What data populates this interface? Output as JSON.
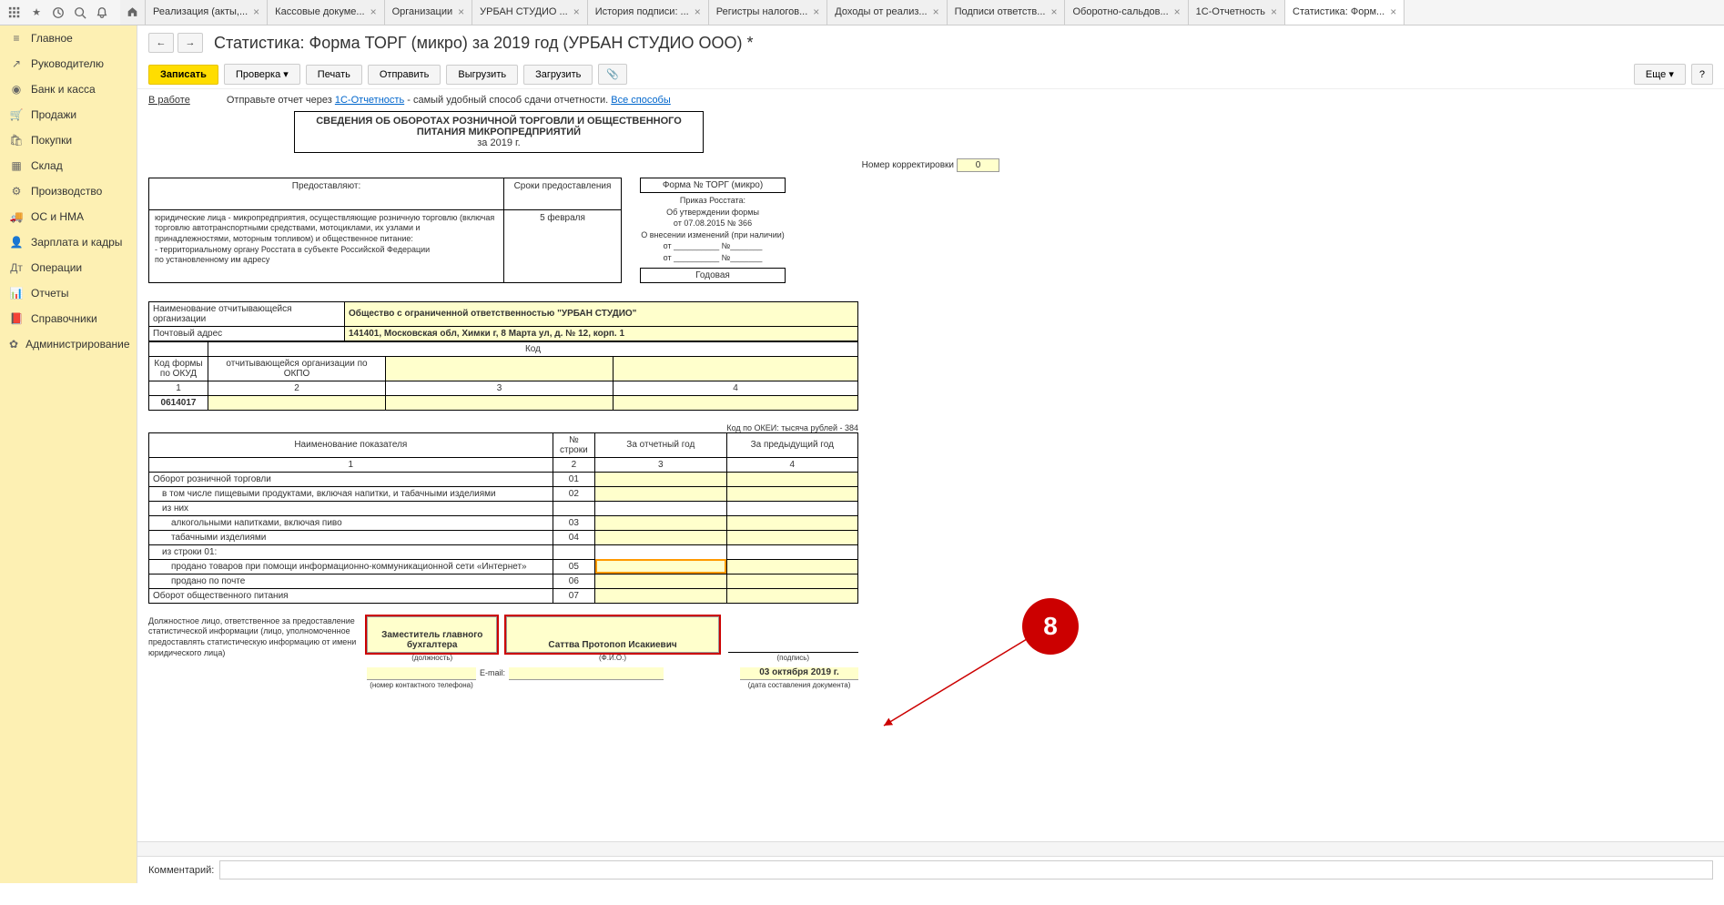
{
  "topIcons": [
    "apps",
    "star",
    "history",
    "search",
    "bell"
  ],
  "tabs": [
    {
      "label": "Реализация (акты,..."
    },
    {
      "label": "Кассовые докуме..."
    },
    {
      "label": "Организации"
    },
    {
      "label": "УРБАН СТУДИО ..."
    },
    {
      "label": "История подписи: ..."
    },
    {
      "label": "Регистры налогов..."
    },
    {
      "label": "Доходы от реализ..."
    },
    {
      "label": "Подписи ответств..."
    },
    {
      "label": "Оборотно-сальдов..."
    },
    {
      "label": "1С-Отчетность"
    },
    {
      "label": "Статистика: Форм...",
      "active": true
    }
  ],
  "sidebar": [
    {
      "icon": "≡",
      "label": "Главное"
    },
    {
      "icon": "↗",
      "label": "Руководителю"
    },
    {
      "icon": "◉",
      "label": "Банк и касса"
    },
    {
      "icon": "🛒",
      "label": "Продажи"
    },
    {
      "icon": "🛍",
      "label": "Покупки"
    },
    {
      "icon": "▦",
      "label": "Склад"
    },
    {
      "icon": "⚙",
      "label": "Производство"
    },
    {
      "icon": "🚚",
      "label": "ОС и НМА"
    },
    {
      "icon": "👤",
      "label": "Зарплата и кадры"
    },
    {
      "icon": "Дт",
      "label": "Операции"
    },
    {
      "icon": "📊",
      "label": "Отчеты"
    },
    {
      "icon": "📕",
      "label": "Справочники"
    },
    {
      "icon": "✿",
      "label": "Администрирование"
    }
  ],
  "pageTitle": "Статистика: Форма ТОРГ (микро) за 2019 год (УРБАН СТУДИО ООО) *",
  "actions": {
    "write": "Записать",
    "check": "Проверка",
    "print": "Печать",
    "send": "Отправить",
    "export": "Выгрузить",
    "import": "Загрузить",
    "more": "Еще"
  },
  "infoBar": {
    "status": "В работе",
    "text1": "Отправьте отчет через ",
    "link1": "1С-Отчетность",
    "text2": " - самый удобный способ сдачи отчетности. ",
    "link2": "Все способы"
  },
  "doc": {
    "headerTitle": "СВЕДЕНИЯ ОБ ОБОРОТАХ РОЗНИЧНОЙ ТОРГОВЛИ И ОБЩЕСТВЕННОГО ПИТАНИЯ МИКРОПРЕДПРИЯТИЙ",
    "period": "за 2019 г.",
    "correctionLabel": "Номер корректировки",
    "correctionValue": "0",
    "infoCol1Header": "Предоставляют:",
    "infoCol2Header": "Сроки предоставления",
    "infoCol1Text": "юридические лица - микропредприятия, осуществляющие  розничную торговлю (включая торговлю автотранспортными средствами, мотоциклами, их узлами и принадлежностями, моторным топливом) и общественное питание:\n   - территориальному органу Росстата в субъекте Российской Федерации\n   по установленному им адресу",
    "infoCol2Text": "5 февраля",
    "formName": "Форма № ТОРГ (микро)",
    "formOrder": "Приказ Росстата:\nОб утверждении формы\nот 07.08.2015 № 366\nО внесении изменений (при наличии)\nот __________ №_______\nот __________ №_______",
    "yearLabel": "Годовая",
    "orgNameLabel": "Наименование отчитывающейся организации",
    "orgName": "Общество с ограниченной ответственностью \"УРБАН СТУДИО\"",
    "addrLabel": "Почтовый адрес",
    "addr": "141401, Московская обл, Химки г, 8 Марта ул, д. № 12, корп. 1",
    "codeHeader": "Код",
    "okudLabel": "Код формы по ОКУД",
    "okpoLabel": "отчитывающейся организации по ОКПО",
    "okudValue": "0614017",
    "colNums": [
      "1",
      "2",
      "3",
      "4"
    ],
    "okeiLabel": "Код по ОКЕИ: тысяча рублей - 384",
    "tableHeaders": [
      "Наименование показателя",
      "№ строки",
      "За отчетный год",
      "За предыдущий год"
    ],
    "tableSubNums": [
      "1",
      "2",
      "3",
      "4"
    ],
    "rows": [
      {
        "name": "Оборот розничной торговли",
        "num": "01",
        "indent": 0
      },
      {
        "name": "в том числе пищевыми продуктами, включая напитки, и табачными изделиями",
        "num": "02",
        "indent": 1
      },
      {
        "name": "из них",
        "num": "",
        "indent": 1
      },
      {
        "name": "алкогольными напитками, включая пиво",
        "num": "03",
        "indent": 2
      },
      {
        "name": "табачными изделиями",
        "num": "04",
        "indent": 2
      },
      {
        "name": "из строки 01:",
        "num": "",
        "indent": 1
      },
      {
        "name": "продано товаров при помощи информационно-коммуникационной сети «Интернет»",
        "num": "05",
        "indent": 2,
        "sel": true
      },
      {
        "name": "продано по почте",
        "num": "06",
        "indent": 2
      },
      {
        "name": "Оборот общественного питания",
        "num": "07",
        "indent": 0
      }
    ],
    "sigLeft": "Должностное лицо, ответственное за предоставление статистической информации (лицо, уполномоченное предоставлять статистическую информацию от имени юридического лица)",
    "sigPosition": "Заместитель главного бухгалтера",
    "sigName": "Саттва Протопоп Исакиевич",
    "sigCaptions": [
      "(должность)",
      "(Ф.И.О.)",
      "(подпись)"
    ],
    "emailLabel": "E-mail:",
    "phoneCaption": "(номер контактного телефона)",
    "date": "03 октября 2019 г.",
    "dateCaption": "(дата составления документа)"
  },
  "callout": {
    "num": "8"
  },
  "commentLabel": "Комментарий:"
}
